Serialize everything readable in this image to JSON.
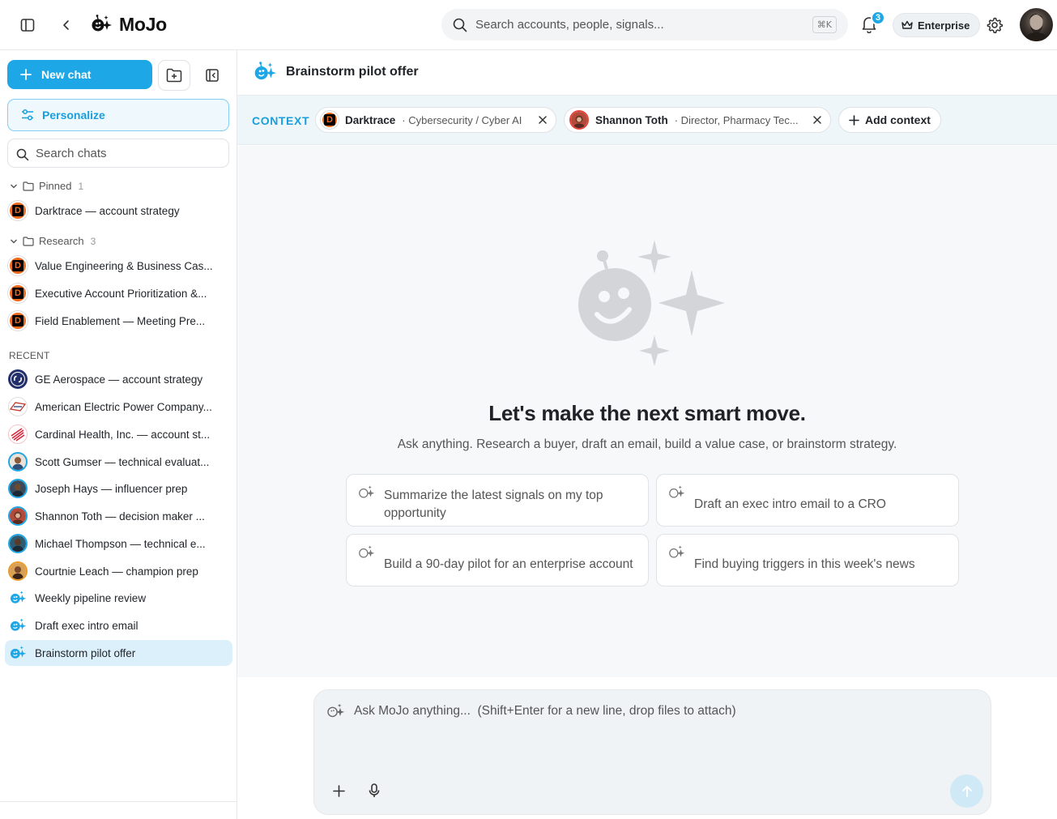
{
  "app": {
    "name": "MoJo"
  },
  "topbar": {
    "search_placeholder": "Search accounts, people, signals...",
    "search_kbd": "⌘K",
    "notification_count": "3",
    "plan_label": "Enterprise"
  },
  "sidebar": {
    "new_chat_label": "New chat",
    "personalize_label": "Personalize",
    "search_placeholder": "Search chats",
    "pinned": {
      "label": "Pinned",
      "count": "1",
      "items": [
        {
          "label": "Darktrace — account strategy"
        }
      ]
    },
    "research": {
      "label": "Research",
      "count": "3",
      "items": [
        {
          "label": "Value Engineering & Business Cas..."
        },
        {
          "label": "Executive Account Prioritization &..."
        },
        {
          "label": "Field Enablement — Meeting Pre..."
        }
      ]
    },
    "recent_label": "RECENT",
    "recent": [
      {
        "label": "GE Aerospace — account strategy",
        "icon": "ge-logo-icon"
      },
      {
        "label": "American Electric Power Company...",
        "icon": "aep-logo-icon"
      },
      {
        "label": "Cardinal Health, Inc. — account st...",
        "icon": "cardinal-logo-icon"
      },
      {
        "label": "Scott Gumser — technical evaluat...",
        "icon": "person-avatar"
      },
      {
        "label": "Joseph Hays — influencer prep",
        "icon": "person-avatar"
      },
      {
        "label": "Shannon Toth — decision maker ...",
        "icon": "person-avatar"
      },
      {
        "label": "Michael Thompson — technical e...",
        "icon": "person-avatar"
      },
      {
        "label": "Courtnie Leach — champion prep",
        "icon": "person-avatar"
      },
      {
        "label": "Weekly pipeline review",
        "icon": "mojo-sparkle-icon"
      },
      {
        "label": "Draft exec intro email",
        "icon": "mojo-sparkle-icon"
      },
      {
        "label": "Brainstorm pilot offer",
        "icon": "mojo-sparkle-icon",
        "active": true
      }
    ]
  },
  "main": {
    "chat_title": "Brainstorm pilot offer",
    "context": {
      "label": "CONTEXT",
      "chips": [
        {
          "name": "Darktrace",
          "sub": "· Cybersecurity / Cyber AI"
        },
        {
          "name": "Shannon Toth",
          "sub": "· Director, Pharmacy Tec..."
        }
      ],
      "add_label": "Add context"
    },
    "headline": "Let's make the next smart move.",
    "subline": "Ask anything. Research a buyer, draft an email, build a value case, or brainstorm strategy.",
    "suggestions": [
      {
        "label": "Summarize the latest signals on my top opportunity"
      },
      {
        "label": "Draft an exec intro email to a CRO"
      },
      {
        "label": "Build a 90-day pilot for an enterprise account"
      },
      {
        "label": "Find buying triggers in this week's news"
      }
    ],
    "composer_placeholder": "Ask MoJo anything...  (Shift+Enter for a new line, drop files to attach)"
  },
  "colors": {
    "accent": "#1ea7e6",
    "darktrace_orange": "#ee6a1f",
    "active_bg": "#dcf0fb"
  }
}
